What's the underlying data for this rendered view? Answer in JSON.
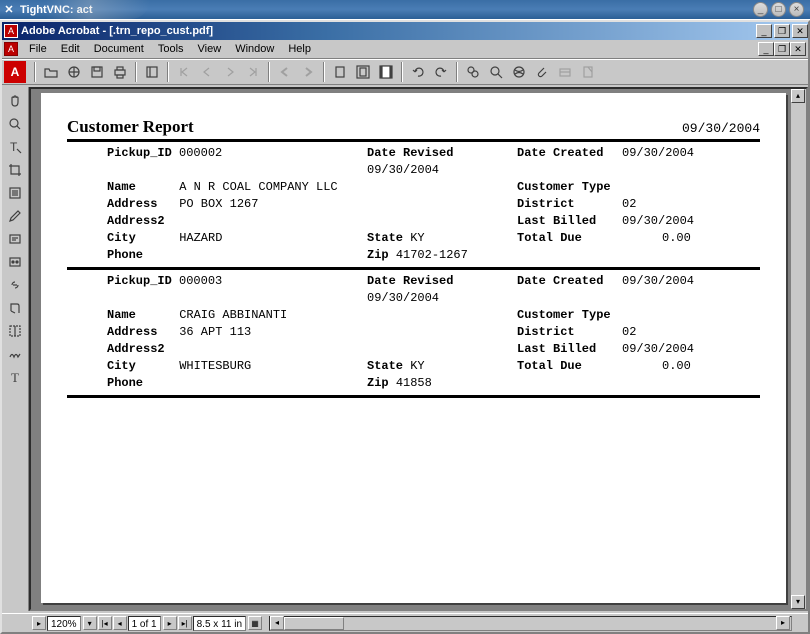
{
  "vnc": {
    "title": "TightVNC: act"
  },
  "acrobat": {
    "title": "Adobe Acrobat - [.trn_repo_cust.pdf]",
    "menu": {
      "file": "File",
      "edit": "Edit",
      "document": "Document",
      "tools": "Tools",
      "view": "View",
      "window": "Window",
      "help": "Help"
    }
  },
  "status": {
    "zoom": "120%",
    "page": "1 of 1",
    "size": "8.5 x 11 in"
  },
  "report": {
    "title": "Customer Report",
    "date": "09/30/2004",
    "labels": {
      "pickup_id": "Pickup_ID",
      "date_revised": "Date Revised",
      "date_created": "Date Created",
      "name": "Name",
      "customer_type": "Customer Type",
      "address": "Address",
      "district": "District",
      "address2": "Address2",
      "last_billed": "Last Billed",
      "city": "City",
      "state": "State",
      "total_due": "Total Due",
      "phone": "Phone",
      "zip": "Zip"
    },
    "records": [
      {
        "pickup_id": "000002",
        "date_revised": "09/30/2004",
        "date_created": "09/30/2004",
        "name": "A N R COAL COMPANY LLC",
        "customer_type": "",
        "address": "PO BOX 1267",
        "district": "02",
        "address2": "",
        "last_billed": "09/30/2004",
        "city": "HAZARD",
        "state": "KY",
        "total_due": "0.00",
        "phone": "",
        "zip": "41702-1267"
      },
      {
        "pickup_id": "000003",
        "date_revised": "09/30/2004",
        "date_created": "09/30/2004",
        "name": "CRAIG   ABBINANTI",
        "customer_type": "",
        "address": "36 APT 113",
        "district": "02",
        "address2": "",
        "last_billed": "09/30/2004",
        "city": "WHITESBURG",
        "state": "KY",
        "total_due": "0.00",
        "phone": "",
        "zip": "41858"
      }
    ]
  }
}
